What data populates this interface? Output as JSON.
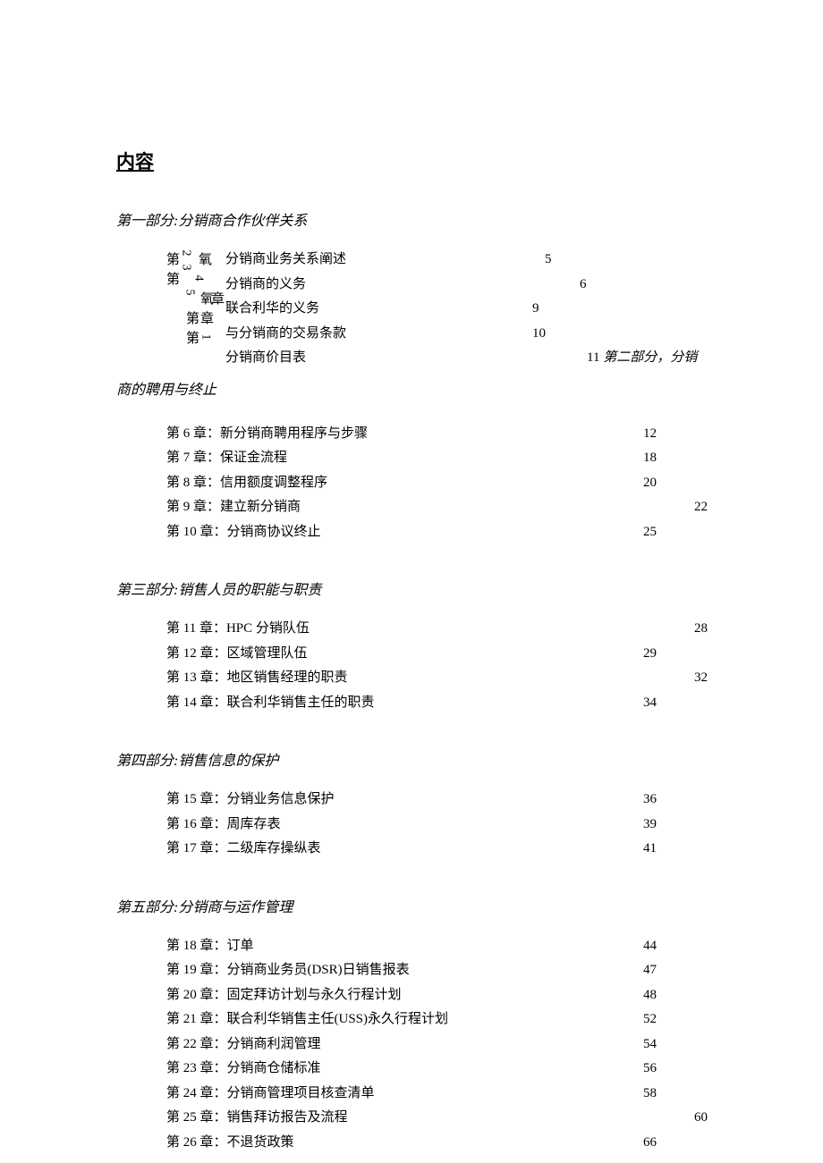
{
  "title": "内容",
  "section1": {
    "heading": "第一部分:分销商合作伙伴关系",
    "rotated": {
      "di1": "第",
      "di2": "第",
      "di3": "第",
      "di4": "第",
      "zhang1": "氧",
      "zhang2": "章",
      "zhang3": "章",
      "zhang4": "氧",
      "n2": "2",
      "n3": "3",
      "n4": "4",
      "n5": "5",
      "n1": "1"
    },
    "items": [
      {
        "label": "分销商业务关系阐述",
        "page": "5",
        "pageLeft": 357
      },
      {
        "label": "分销商的义务",
        "page": "6",
        "pageLeft": 396
      },
      {
        "label": "联合利华的义务",
        "page": "9",
        "pageLeft": 343
      },
      {
        "label": "与分销商的交易条款",
        "page": "10",
        "pageLeft": 343
      },
      {
        "label": "分销商价目表",
        "page": "11",
        "pageLeft": 404,
        "tail": " 第二部分，分销"
      }
    ],
    "tail_line2": "商的聘用与终止"
  },
  "section2": {
    "items": [
      {
        "label": "第 6 章：新分销商聘用程序与步骤",
        "page": "12",
        "pageLeft": 533
      },
      {
        "label": "第 7 章：保证金流程",
        "page": "18",
        "pageLeft": 533
      },
      {
        "label": "第 8 章：信用额度调整程序",
        "page": "20",
        "pageLeft": 533
      },
      {
        "label": "第 9 章：建立新分销商",
        "page": "22",
        "pageLeft": 590
      },
      {
        "label": "第 10 章：分销商协议终止",
        "page": "25",
        "pageLeft": 533
      }
    ]
  },
  "section3": {
    "heading": "第三部分:销售人员的职能与职责",
    "items": [
      {
        "label": "第 11 章：HPC 分销队伍",
        "page": "28",
        "pageLeft": 590
      },
      {
        "label": "第 12 章：区域管理队伍",
        "page": "29",
        "pageLeft": 533
      },
      {
        "label": "第 13 章：地区销售经理的职责",
        "page": "32",
        "pageLeft": 590
      },
      {
        "label": "第 14 章：联合利华销售主任的职责",
        "page": "34",
        "pageLeft": 533
      }
    ]
  },
  "section4": {
    "heading": "第四部分:销售信息的保护",
    "items": [
      {
        "label": "第 15 章：分销业务信息保护",
        "page": "36",
        "pageLeft": 533
      },
      {
        "label": "第 16 章：周库存表",
        "page": "39",
        "pageLeft": 533
      },
      {
        "label": "第 17 章：二级库存操纵表",
        "page": "41",
        "pageLeft": 533
      }
    ]
  },
  "section5": {
    "heading": "第五部分:分销商与运作管理",
    "items": [
      {
        "label": "第 18 章：订单",
        "page": "44",
        "pageLeft": 533
      },
      {
        "label": "第 19 章：分销商业务员(DSR)日销售报表",
        "page": "47",
        "pageLeft": 533
      },
      {
        "label": "第 20 章：固定拜访计划与永久行程计划",
        "page": "48",
        "pageLeft": 533
      },
      {
        "label": "第 21 章：联合利华销售主任(USS)永久行程计划",
        "page": "52",
        "pageLeft": 533
      },
      {
        "label": "第 22 章：分销商利润管理",
        "page": "54",
        "pageLeft": 533
      },
      {
        "label": "第 23 章：分销商仓储标准",
        "page": "56",
        "pageLeft": 533
      },
      {
        "label": "第 24 章：分销商管理项目核查清单",
        "page": "58",
        "pageLeft": 533
      },
      {
        "label": "第 25 章：销售拜访报告及流程",
        "page": "60",
        "pageLeft": 590
      },
      {
        "label": "第 26 章：不退货政策",
        "page": "66",
        "pageLeft": 533
      }
    ]
  }
}
